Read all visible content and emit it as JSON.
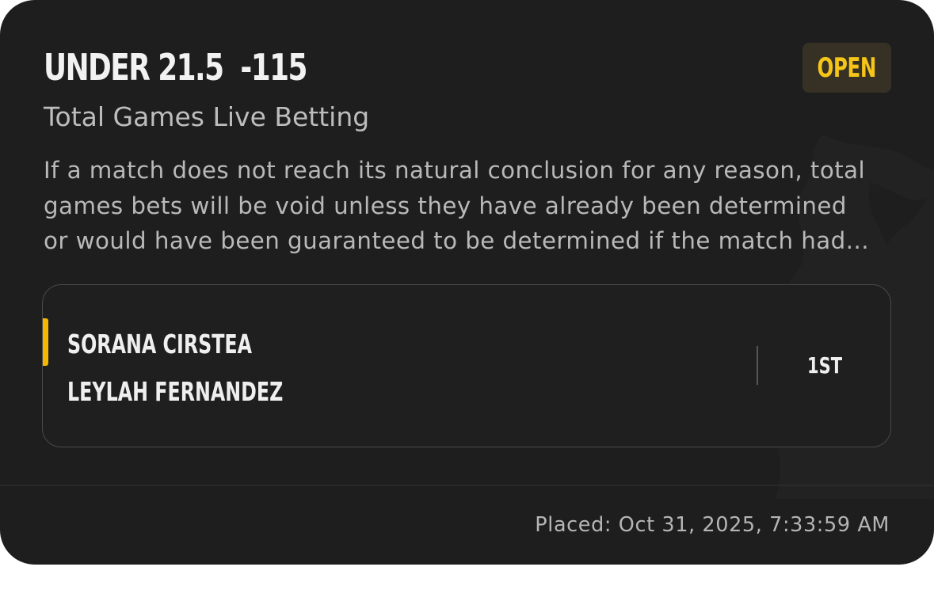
{
  "bet": {
    "selection": "UNDER 21.5",
    "odds": "-115",
    "status": "OPEN",
    "market": "Total Games Live Betting",
    "rules_lines": [
      "If a match does not reach its natural conclusion for any reason, total",
      "games bets will be void unless they have already been determined",
      "or would have been guaranteed to be determined if the match had..."
    ]
  },
  "event": {
    "participants": [
      "SORANA CIRSTEA",
      "LEYLAH FERNANDEZ"
    ],
    "period": "1ST"
  },
  "footer": {
    "placed": "Placed: Oct 31, 2025, 7:33:59 AM"
  },
  "colors": {
    "card_bg": "#1e1e1e",
    "accent_yellow": "#f5c518",
    "badge_bg": "#363124",
    "text_primary": "#f2f2f2",
    "text_secondary": "#b9b9b9"
  },
  "icons": {
    "watermark": "team-logo-watermark-icon",
    "active_indicator": "active-player-indicator"
  }
}
